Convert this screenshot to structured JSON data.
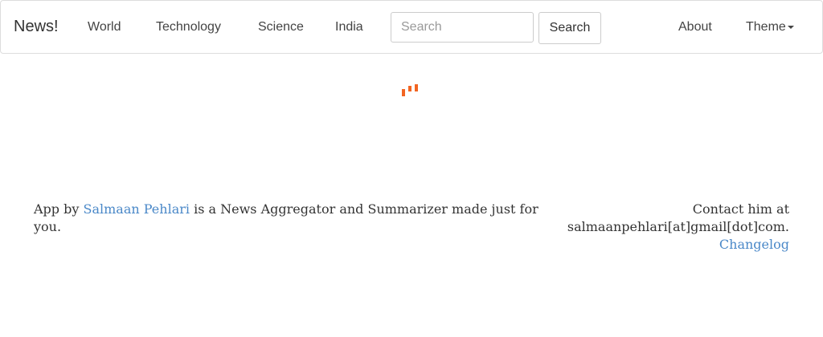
{
  "navbar": {
    "brand": "News!",
    "items": [
      {
        "label": "World"
      },
      {
        "label": "Technology"
      },
      {
        "label": "Science"
      },
      {
        "label": "India"
      }
    ],
    "search": {
      "placeholder": "Search",
      "value": "",
      "button_label": "Search"
    },
    "right_items": [
      {
        "label": "About"
      },
      {
        "label": "Theme"
      }
    ]
  },
  "loader": {
    "icon": "loading-spinner-icon",
    "color": "#f26522"
  },
  "footer": {
    "left_prefix": "App by ",
    "author_link": "Salmaan Pehlari",
    "left_suffix": " is a News Aggregator and Summarizer made just for you.",
    "contact_line1": "Contact him at",
    "contact_line2": "salmaanpehlari[at]gmail[dot]com.",
    "changelog_link": "Changelog",
    "link_color": "#4a88c8"
  }
}
